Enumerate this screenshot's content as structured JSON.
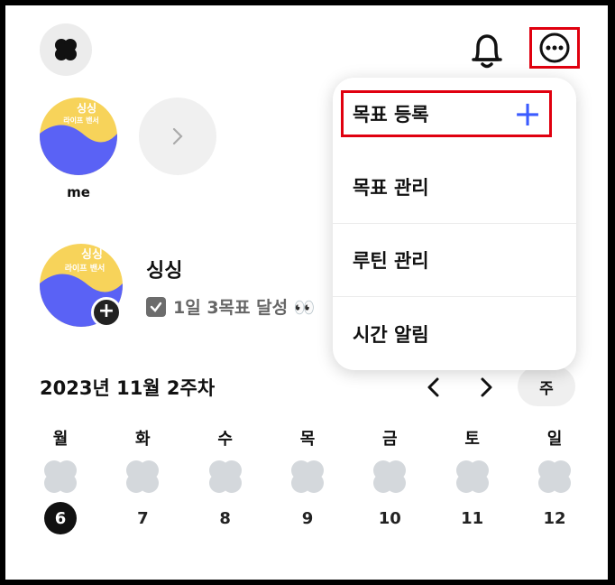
{
  "header": {
    "logo_icon": "clover-icon",
    "bell_icon": "bell-icon",
    "more_icon": "more-horizontal-icon"
  },
  "friends": {
    "me_label": "me",
    "avatar_top_text": "싱싱",
    "avatar_sub_text": "라이프 밴서"
  },
  "profile": {
    "name": "싱싱",
    "goal_text": "1일 3목표 달성 👀"
  },
  "week": {
    "title": "2023년 11월 2주차",
    "view_label": "주",
    "days": [
      {
        "name": "월",
        "num": "6",
        "today": true
      },
      {
        "name": "화",
        "num": "7"
      },
      {
        "name": "수",
        "num": "8"
      },
      {
        "name": "목",
        "num": "9"
      },
      {
        "name": "금",
        "num": "10"
      },
      {
        "name": "토",
        "num": "11"
      },
      {
        "name": "일",
        "num": "12"
      }
    ]
  },
  "menu": {
    "items": [
      {
        "label": "목표 등록"
      },
      {
        "label": "목표 관리"
      },
      {
        "label": "루틴 관리"
      },
      {
        "label": "시간 알림"
      }
    ],
    "plus_symbol": "+"
  },
  "colors": {
    "highlight": "#e0000f",
    "accent": "#3b5bff",
    "avatar_yellow": "#f7d35a",
    "avatar_blue": "#5a62f5"
  }
}
